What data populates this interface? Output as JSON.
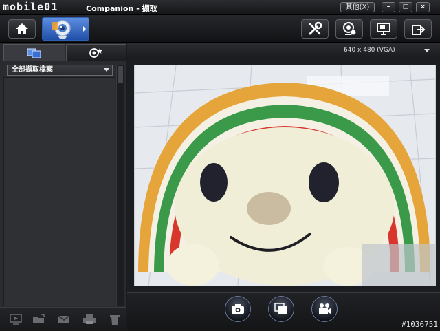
{
  "titlebar": {
    "logo_text": "mobile01",
    "title": "Companion - 擷取",
    "other_label": "其他(X)",
    "minimize_label": "–",
    "maximize_label": "□",
    "close_label": "×"
  },
  "toolbar": {
    "icons": [
      "home-icon",
      "webcam-capture-icon",
      "tools-icon",
      "webcam-settings-icon",
      "monitor-icon",
      "export-icon"
    ]
  },
  "left_panel": {
    "filter_label": "全部擷取檔案",
    "bottom_icons": [
      "play-icon",
      "open-folder-icon",
      "email-icon",
      "print-icon",
      "trash-icon"
    ]
  },
  "right_panel": {
    "resolution_label": "640 x 480 (VGA)",
    "action_icons": [
      "camera-icon",
      "burst-capture-icon",
      "video-record-icon"
    ]
  },
  "watermark": "#1036751",
  "colors": {
    "accent_blue": "#3a6fd0",
    "background": "#1a1b1e",
    "panel": "#2a2b2f"
  }
}
